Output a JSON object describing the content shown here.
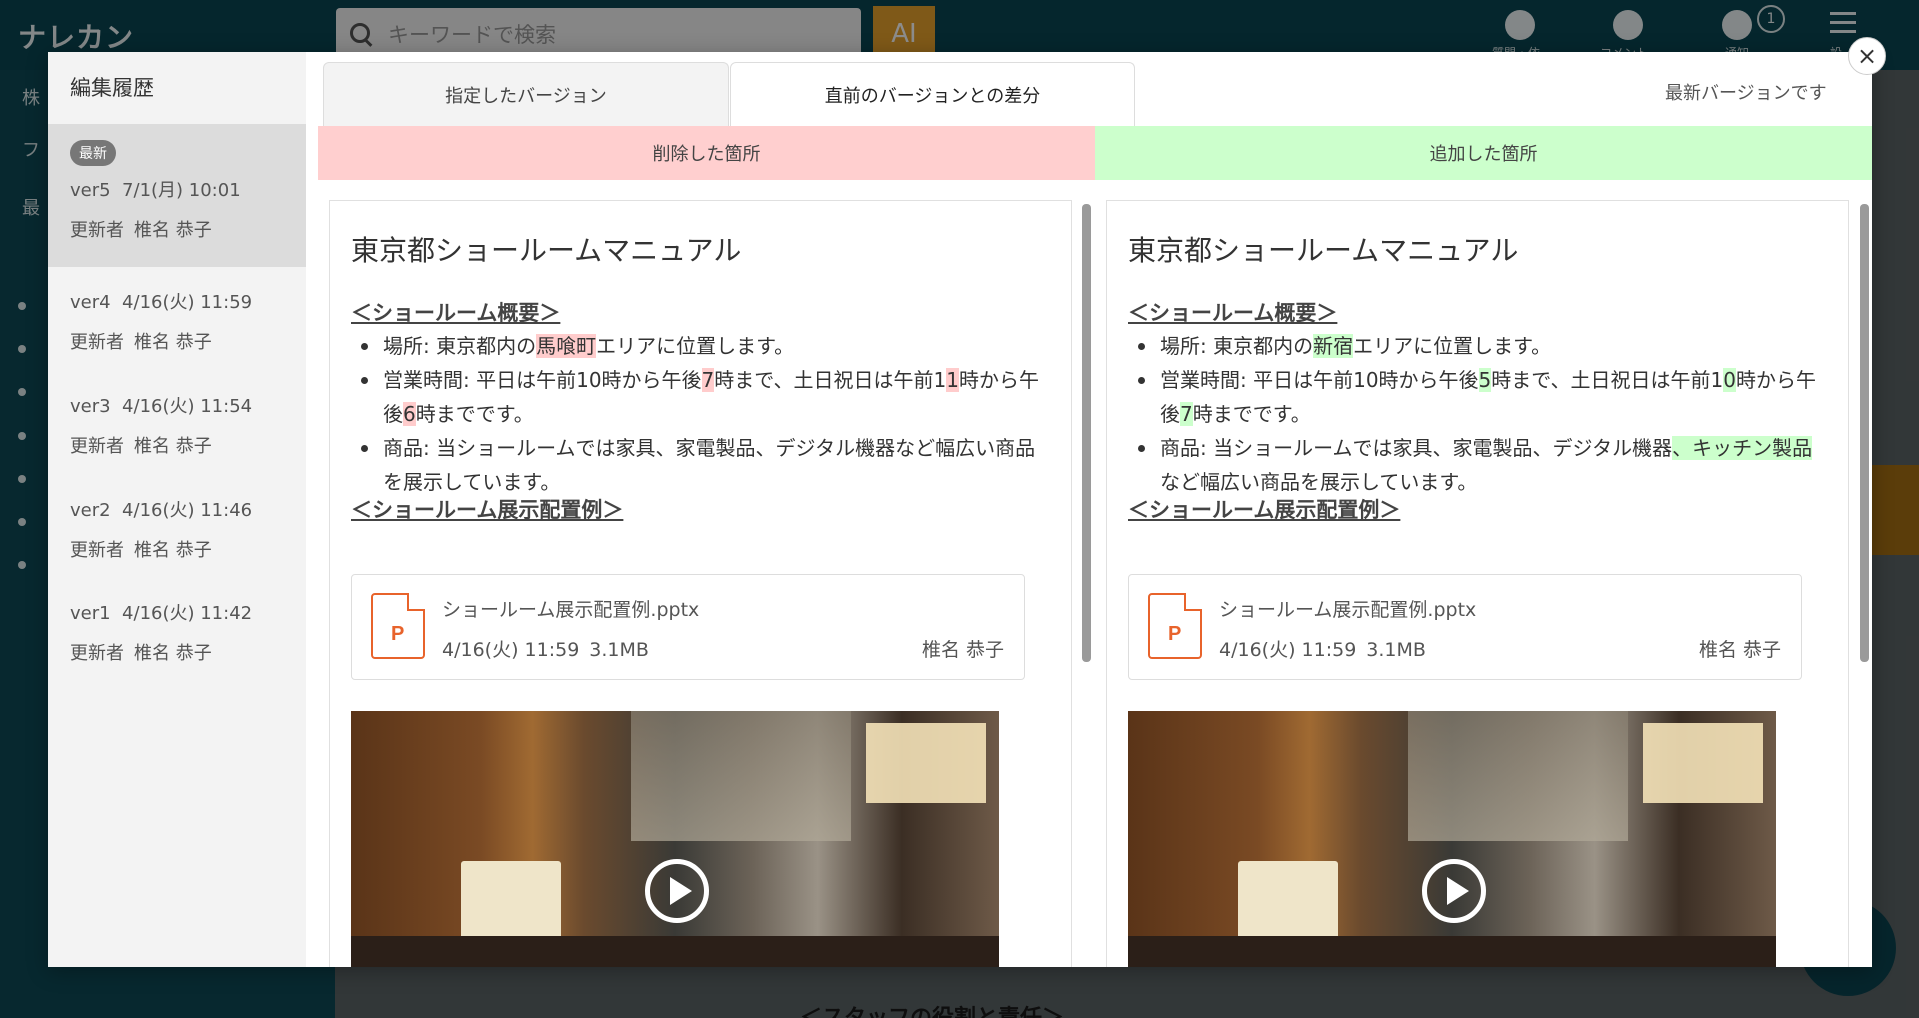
{
  "app": {
    "logo": "ナレカン",
    "search_placeholder": "キーワードで検索",
    "ai_label": "AI",
    "header_labels": [
      "質問・依",
      "コメント",
      "通知",
      "設"
    ],
    "notification_count": "1",
    "sidebar_snippets": [
      "株",
      "フ",
      "最"
    ],
    "bottom_heading": "＜スタッフの役割と責任＞"
  },
  "modal": {
    "history_title": "編集履歴",
    "versions": [
      {
        "badge": "最新",
        "version": "ver5",
        "date": "7/1(月) 10:01",
        "updater_label": "更新者",
        "updater": "椎名 恭子"
      },
      {
        "version": "ver4",
        "date": "4/16(火) 11:59",
        "updater_label": "更新者",
        "updater": "椎名 恭子"
      },
      {
        "version": "ver3",
        "date": "4/16(火) 11:54",
        "updater_label": "更新者",
        "updater": "椎名 恭子"
      },
      {
        "version": "ver2",
        "date": "4/16(火) 11:46",
        "updater_label": "更新者",
        "updater": "椎名 恭子"
      },
      {
        "version": "ver1",
        "date": "4/16(火) 11:42",
        "updater_label": "更新者",
        "updater": "椎名 恭子"
      }
    ],
    "tabs": [
      "指定したバージョン",
      "直前のバージョンとの差分"
    ],
    "latest_note": "最新バージョンです",
    "deleted_header": "削除した箇所",
    "added_header": "追加した箇所",
    "close_label": "×"
  },
  "document": {
    "title": "東京都ショールームマニュアル",
    "section1": "＜ショールーム概要＞",
    "section2": "＜ショールーム展示配置例＞",
    "left": {
      "b1": [
        "場所: 東京都内の",
        "馬喰町",
        "エリアに位置します。"
      ],
      "b2": [
        "営業時間: 平日は午前10時から午後",
        "7",
        "時まで、土日祝日は午前1",
        "1",
        "時から午後",
        "6",
        "時までです。"
      ],
      "b3": [
        "商品: 当ショールームでは家具、家電製品、デジタル機器など幅広い商品を展示しています。"
      ]
    },
    "right": {
      "b1": [
        "場所: 東京都内の",
        "新宿",
        "エリアに位置します。"
      ],
      "b2": [
        "営業時間: 平日は午前10時から午後",
        "5",
        "時まで、土日祝日は午前1",
        "0",
        "時から午後",
        "7",
        "時までです。"
      ],
      "b3": [
        "商品: 当ショールームでは家具、家電製品、デジタル機器",
        "、キッチン製品",
        "など幅広い商品を展示しています。"
      ]
    },
    "file": {
      "icon_letter": "P",
      "name": "ショールーム展示配置例.pptx",
      "date": "4/16(火) 11:59",
      "size": "3.1MB",
      "owner": "椎名 恭子"
    }
  }
}
